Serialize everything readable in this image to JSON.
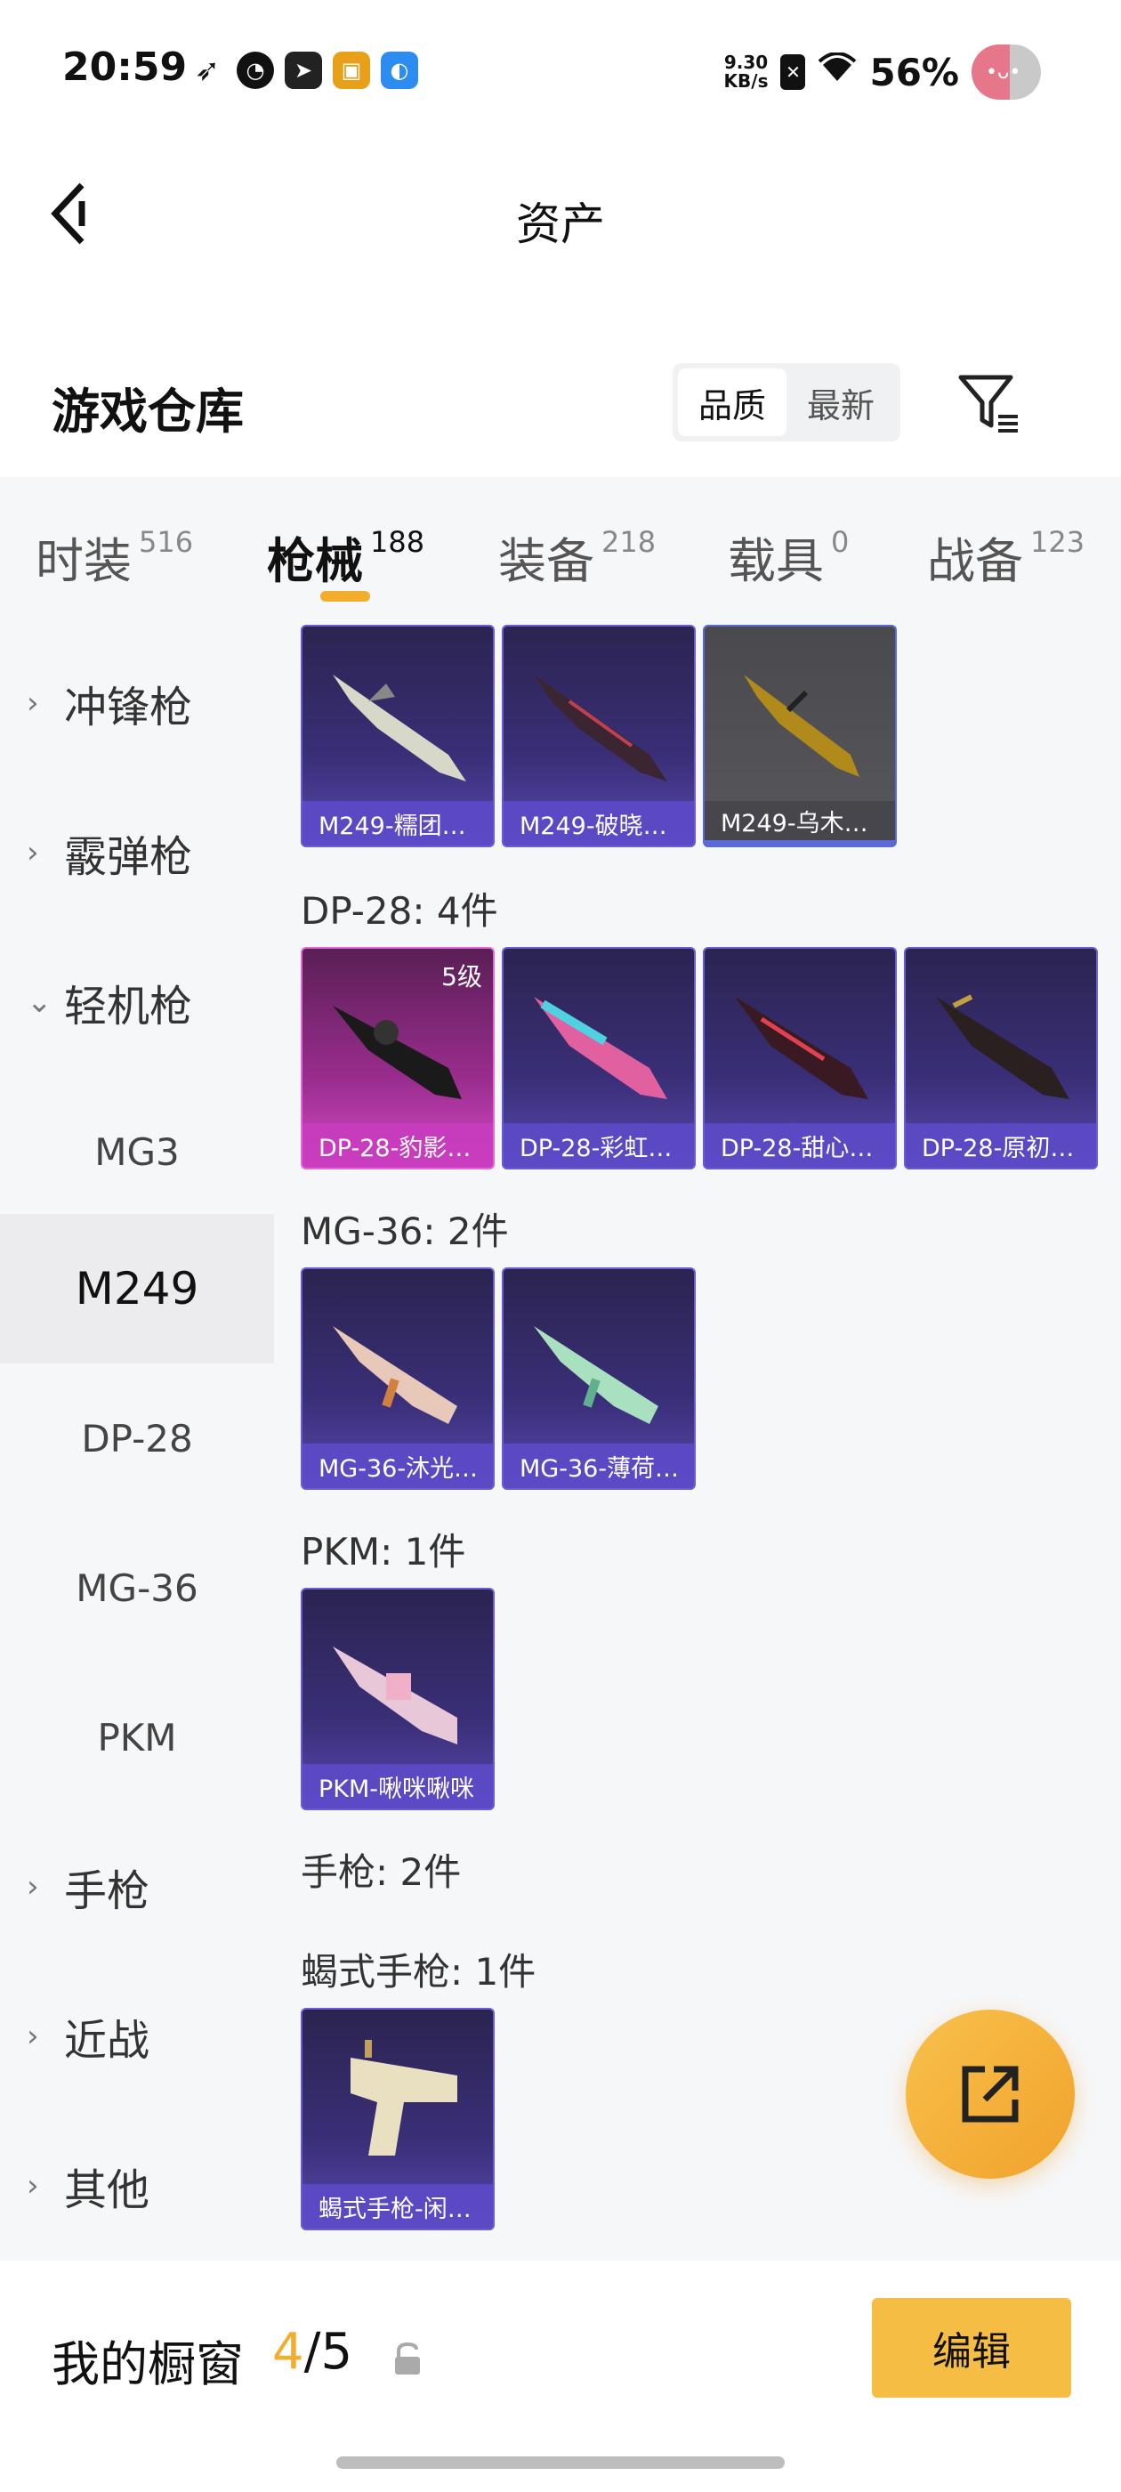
{
  "status_bar": {
    "time": "20:59",
    "net_speed_value": "9.30",
    "net_speed_unit": "KB/s",
    "battery": "56%"
  },
  "nav": {
    "title": "资产"
  },
  "warehouse": {
    "title": "游戏仓库",
    "sort_options": [
      "品质",
      "最新"
    ],
    "active_sort": "品质"
  },
  "tabs": [
    {
      "label": "时装",
      "count": "516"
    },
    {
      "label": "枪械",
      "count": "188"
    },
    {
      "label": "装备",
      "count": "218"
    },
    {
      "label": "载具",
      "count": "0"
    },
    {
      "label": "战备",
      "count": "123"
    }
  ],
  "sidebar": {
    "items": [
      {
        "label": "冲锋枪"
      },
      {
        "label": "霰弹枪"
      },
      {
        "label": "轻机枪"
      },
      {
        "label": "MG3"
      },
      {
        "label": "M249"
      },
      {
        "label": "DP-28"
      },
      {
        "label": "MG-36"
      },
      {
        "label": "PKM"
      },
      {
        "label": "手枪"
      },
      {
        "label": "近战"
      },
      {
        "label": "其他"
      }
    ]
  },
  "content": {
    "m249_cards": [
      {
        "label": "M249-糯团…"
      },
      {
        "label": "M249-破晓…"
      },
      {
        "label": "M249-乌木…"
      }
    ],
    "dp28_title": "DP-28: 4件",
    "dp28_cards": [
      {
        "label": "DP-28-豹影…",
        "level": "5级"
      },
      {
        "label": "DP-28-彩虹…"
      },
      {
        "label": "DP-28-甜心…"
      },
      {
        "label": "DP-28-原初…"
      }
    ],
    "mg36_title": "MG-36: 2件",
    "mg36_cards": [
      {
        "label": "MG-36-沐光…"
      },
      {
        "label": "MG-36-薄荷…"
      }
    ],
    "pkm_title": "PKM: 1件",
    "pkm_cards": [
      {
        "label": "PKM-啾咪啾咪"
      }
    ],
    "pistol_title": "手枪: 2件",
    "scorpion_title": "蝎式手枪: 1件",
    "scorpion_cards": [
      {
        "label": "蝎式手枪-闲…"
      }
    ]
  },
  "bottom": {
    "showcase_label": "我的橱窗",
    "showcase_used": "4",
    "showcase_total": "/5",
    "edit_label": "编辑"
  },
  "colors": {
    "accent": "#f3ad2c",
    "card_purple": "#3a2f78",
    "card_pink": "#c83cbe"
  }
}
